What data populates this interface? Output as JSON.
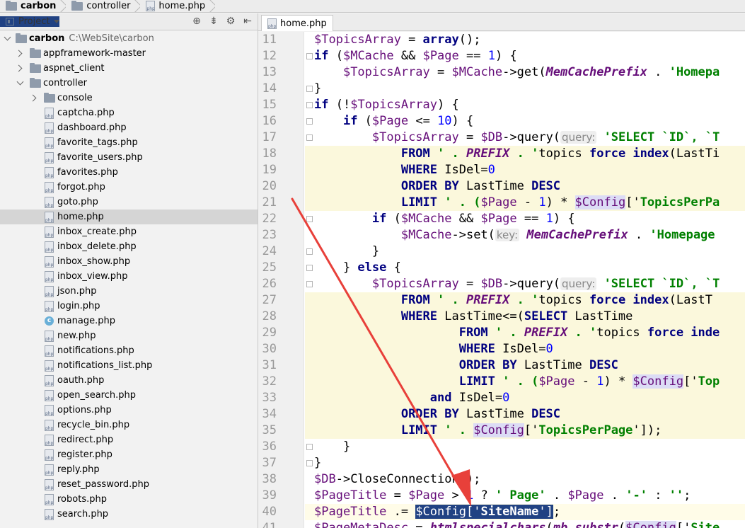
{
  "breadcrumb": [
    {
      "label": "carbon",
      "icon": "folder-icon",
      "bold": true
    },
    {
      "label": "controller",
      "icon": "folder-icon",
      "bold": false
    },
    {
      "label": "home.php",
      "icon": "php-file-icon",
      "bold": false
    }
  ],
  "project_panel": {
    "view_selector": "Project",
    "tools": [
      "crosshair-icon",
      "collapse-icon",
      "gear-icon",
      "hide-icon"
    ],
    "root": {
      "name": "carbon",
      "path": "C:\\WebSite\\carbon"
    },
    "items": [
      {
        "label": "appframework-master",
        "type": "folder",
        "expanded": false
      },
      {
        "label": "aspnet_client",
        "type": "folder",
        "expanded": false
      },
      {
        "label": "controller",
        "type": "folder",
        "expanded": true
      },
      {
        "label": "console",
        "type": "folder",
        "expanded": false
      },
      {
        "label": "captcha.php",
        "type": "php"
      },
      {
        "label": "dashboard.php",
        "type": "php"
      },
      {
        "label": "favorite_tags.php",
        "type": "php"
      },
      {
        "label": "favorite_users.php",
        "type": "php"
      },
      {
        "label": "favorites.php",
        "type": "php"
      },
      {
        "label": "forgot.php",
        "type": "php"
      },
      {
        "label": "goto.php",
        "type": "php"
      },
      {
        "label": "home.php",
        "type": "php",
        "selected": true
      },
      {
        "label": "inbox_create.php",
        "type": "php"
      },
      {
        "label": "inbox_delete.php",
        "type": "php"
      },
      {
        "label": "inbox_show.php",
        "type": "php"
      },
      {
        "label": "inbox_view.php",
        "type": "php"
      },
      {
        "label": "json.php",
        "type": "php"
      },
      {
        "label": "login.php",
        "type": "php"
      },
      {
        "label": "manage.php",
        "type": "class"
      },
      {
        "label": "new.php",
        "type": "php"
      },
      {
        "label": "notifications.php",
        "type": "php"
      },
      {
        "label": "notifications_list.php",
        "type": "php"
      },
      {
        "label": "oauth.php",
        "type": "php"
      },
      {
        "label": "open_search.php",
        "type": "php"
      },
      {
        "label": "options.php",
        "type": "php"
      },
      {
        "label": "recycle_bin.php",
        "type": "php"
      },
      {
        "label": "redirect.php",
        "type": "php"
      },
      {
        "label": "register.php",
        "type": "php"
      },
      {
        "label": "reply.php",
        "type": "php"
      },
      {
        "label": "reset_password.php",
        "type": "php"
      },
      {
        "label": "robots.php",
        "type": "php"
      },
      {
        "label": "search.php",
        "type": "php"
      }
    ]
  },
  "editor": {
    "tab_label": "home.php",
    "line_numbers": [
      "11",
      "12",
      "13",
      "14",
      "15",
      "16",
      "17",
      "18",
      "19",
      "20",
      "21",
      "22",
      "23",
      "24",
      "25",
      "26",
      "27",
      "28",
      "29",
      "30",
      "31",
      "32",
      "33",
      "34",
      "35",
      "36",
      "37",
      "38",
      "39",
      "40",
      "41"
    ],
    "code": {
      "l11": [
        "$TopicsArray",
        " = ",
        "array",
        "();"
      ],
      "l12": [
        "if",
        " (",
        "$MCache",
        " && ",
        "$Page",
        " == ",
        "1",
        ") {"
      ],
      "l13": [
        "    ",
        "$TopicsArray",
        " = ",
        "$MCache",
        "->get(",
        "MemCachePrefix",
        " . ",
        "'Homepa"
      ],
      "l14": [
        "}"
      ],
      "l15": [
        "if",
        " (!",
        "$TopicsArray",
        ") {"
      ],
      "l16": [
        "    ",
        "if",
        " (",
        "$Page",
        " <= ",
        "10",
        ") {"
      ],
      "l17": [
        "        ",
        "$TopicsArray",
        " = ",
        "$DB",
        "->query(",
        "query:",
        " ",
        "'SELECT `ID`, `T"
      ],
      "l18": [
        "            ",
        "FROM",
        " ' . ",
        "PREFIX",
        " . '",
        "topics ",
        "force index",
        "(LastTi"
      ],
      "l19": [
        "            ",
        "WHERE",
        " IsDel=",
        "0"
      ],
      "l20": [
        "            ",
        "ORDER BY",
        " LastTime ",
        "DESC"
      ],
      "l21": [
        "            ",
        "LIMIT",
        " ' . (",
        "$Page",
        " - ",
        "1",
        ") * ",
        "$Config",
        "['",
        "TopicsPerPa"
      ],
      "l22": [
        "        ",
        "if",
        " (",
        "$MCache",
        " && ",
        "$Page",
        " == ",
        "1",
        ") {"
      ],
      "l23": [
        "            ",
        "$MCache",
        "->set(",
        "key:",
        " ",
        "MemCachePrefix",
        " . ",
        "'Homepage"
      ],
      "l24": [
        "        }"
      ],
      "l25": [
        "    } ",
        "else",
        " {"
      ],
      "l26": [
        "        ",
        "$TopicsArray",
        " = ",
        "$DB",
        "->query(",
        "query:",
        " ",
        "'SELECT `ID`, `T"
      ],
      "l27": [
        "            ",
        "FROM",
        " ' . ",
        "PREFIX",
        " . '",
        "topics ",
        "force index",
        "(LastT"
      ],
      "l28": [
        "            ",
        "WHERE",
        " LastTime<=(",
        "SELECT",
        " LastTime"
      ],
      "l29": [
        "                    ",
        "FROM",
        " ' . ",
        "PREFIX",
        " . '",
        "topics ",
        "force inde"
      ],
      "l30": [
        "                    ",
        "WHERE",
        " IsDel=",
        "0"
      ],
      "l31": [
        "                    ",
        "ORDER BY",
        " LastTime ",
        "DESC"
      ],
      "l32": [
        "                    ",
        "LIMIT",
        " ' . (",
        "$Page",
        " - ",
        "1",
        ") * ",
        "$Config",
        "['",
        "Top"
      ],
      "l33": [
        "                ",
        "and",
        " IsDel=",
        "0"
      ],
      "l34": [
        "            ",
        "ORDER BY",
        " LastTime ",
        "DESC"
      ],
      "l35": [
        "            ",
        "LIMIT",
        " ' . ",
        "$Config",
        "['",
        "TopicsPerPage",
        "']);"
      ],
      "l36": [
        "    }"
      ],
      "l37": [
        "}"
      ],
      "l38": [
        "$DB",
        "->CloseConnection();"
      ],
      "l39": [
        "$PageTitle",
        " = ",
        "$Page",
        " > ",
        "1",
        " ? ",
        "' Page'",
        " . ",
        "$Page",
        " . ",
        "'-'",
        " : ",
        "''",
        ";"
      ],
      "l40": [
        "$PageTitle",
        " .= ",
        "$Config",
        "['",
        "SiteName",
        "']",
        ";"
      ],
      "l41": [
        "$PageMetaDesc",
        " = ",
        "htmlspecialchars",
        "(",
        "mb_substr",
        "(",
        "$Config",
        "['",
        "Site"
      ]
    }
  },
  "annotation": {
    "color": "#e8403a"
  }
}
